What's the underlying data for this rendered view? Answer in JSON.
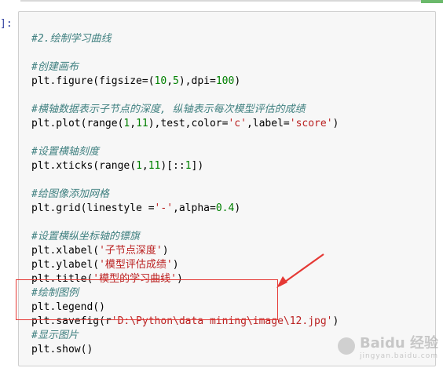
{
  "prompt": "]:",
  "code_lines": [
    {
      "type": "comment",
      "text": "#2.绘制学习曲线"
    },
    {
      "type": "blank",
      "text": ""
    },
    {
      "type": "comment",
      "text": "#创建画布"
    },
    {
      "type": "code",
      "text": "plt.figure(figsize=(10,5),dpi=100)"
    },
    {
      "type": "blank",
      "text": ""
    },
    {
      "type": "comment",
      "text": "#横轴数据表示子节点的深度, 纵轴表示每次模型评估的成绩"
    },
    {
      "type": "code",
      "text": "plt.plot(range(1,11),test,color='c',label='score')"
    },
    {
      "type": "blank",
      "text": ""
    },
    {
      "type": "comment",
      "text": "#设置横轴刻度"
    },
    {
      "type": "code",
      "text": "plt.xticks(range(1,11)[::1])"
    },
    {
      "type": "blank",
      "text": ""
    },
    {
      "type": "comment",
      "text": "#给图像添加网格"
    },
    {
      "type": "code",
      "text": "plt.grid(linestyle ='-',alpha=0.4)"
    },
    {
      "type": "blank",
      "text": ""
    },
    {
      "type": "comment",
      "text": "#设置横纵坐标轴的镖旗"
    },
    {
      "type": "code",
      "text": "plt.xlabel('子节点深度')"
    },
    {
      "type": "code",
      "text": "plt.ylabel('模型评估成绩')"
    },
    {
      "type": "code",
      "text": "plt.title('模型的学习曲线')"
    },
    {
      "type": "comment",
      "text": "#绘制图例"
    },
    {
      "type": "code",
      "text": "plt.legend()"
    },
    {
      "type": "code",
      "text": "plt.savefig(r'D:\\Python\\data mining\\image\\12.jpg')"
    },
    {
      "type": "comment",
      "text": "#显示图片"
    },
    {
      "type": "code",
      "text": "plt.show()"
    }
  ],
  "watermark": {
    "brand": "Baidu 经验",
    "sub": "jingyan.baidu.com"
  },
  "colors": {
    "comment": "#408080",
    "string": "#ba2121",
    "number": "#008000",
    "highlight": "#e53935"
  }
}
